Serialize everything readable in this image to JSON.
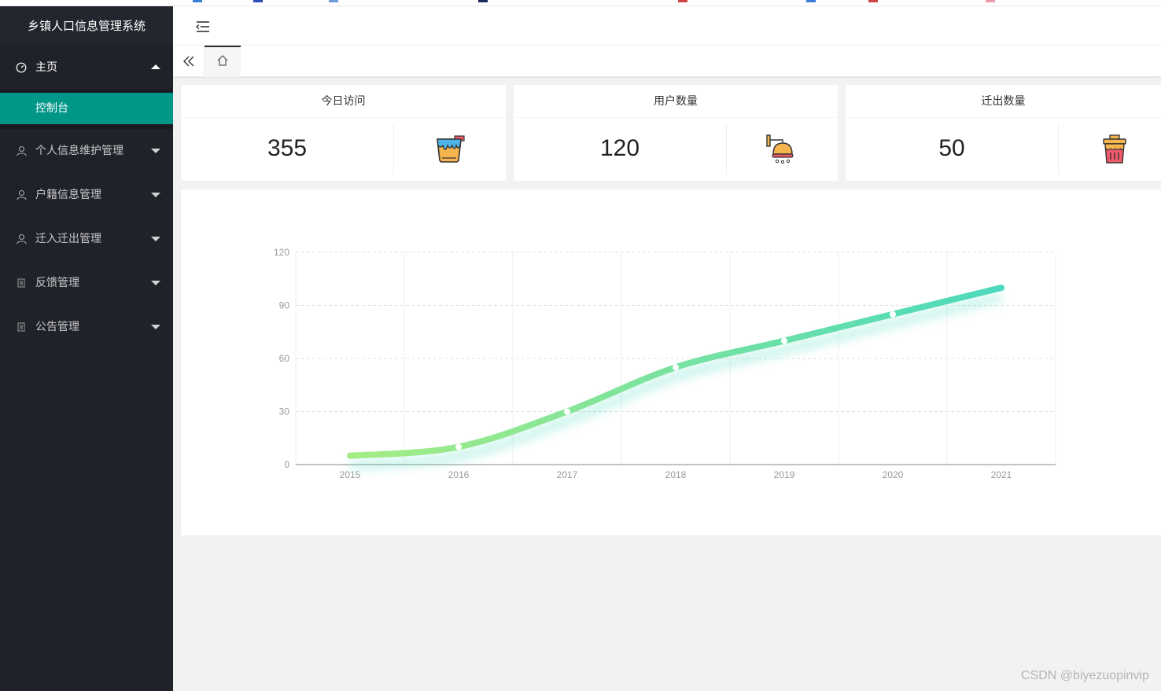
{
  "app": {
    "title": "乡镇人口信息管理系统"
  },
  "sidebar": {
    "home": {
      "label": "主页",
      "icon": "dashboard-icon"
    },
    "home_sub": {
      "label": "控制台"
    },
    "items": [
      {
        "label": "个人信息维护管理",
        "icon": "user-icon"
      },
      {
        "label": "户籍信息管理",
        "icon": "user-icon"
      },
      {
        "label": "迁入迁出管理",
        "icon": "user-icon"
      },
      {
        "label": "反馈管理",
        "icon": "file-icon"
      },
      {
        "label": "公告管理",
        "icon": "file-icon"
      }
    ]
  },
  "header": {
    "toggle_icon": "menu-shrink-icon"
  },
  "tabs": {
    "back_icon": "double-left-icon",
    "home_icon": "home-icon"
  },
  "cards": [
    {
      "title": "今日访问",
      "value": "355",
      "icon": "paint-bucket-icon"
    },
    {
      "title": "用户数量",
      "value": "120",
      "icon": "shower-icon"
    },
    {
      "title": "迁出数量",
      "value": "50",
      "icon": "trash-can-icon"
    }
  ],
  "colors": {
    "sidebar_bg": "#20222a",
    "active": "#009688",
    "line_start": "#a5ec84",
    "line_end": "#4bd9bd"
  },
  "chart_data": {
    "type": "line",
    "smooth": true,
    "categories": [
      "2015",
      "2016",
      "2017",
      "2018",
      "2019",
      "2020",
      "2021"
    ],
    "series": [
      {
        "values": [
          5,
          10,
          30,
          55,
          70,
          85,
          100
        ]
      }
    ],
    "yticks": [
      "0",
      "30",
      "60",
      "90",
      "120"
    ],
    "ylim": [
      0,
      120
    ],
    "grid": true
  },
  "watermark": "CSDN @biyezuopinvip"
}
